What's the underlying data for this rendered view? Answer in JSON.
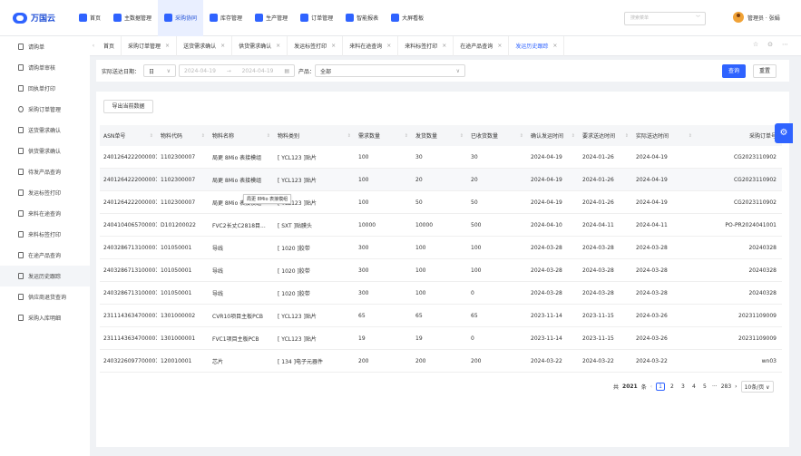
{
  "header": {
    "logo_text": "万国云",
    "nav": [
      {
        "label": "首页",
        "icon": "home-icon",
        "color": "#2f63ff"
      },
      {
        "label": "主数据管理",
        "icon": "database-icon",
        "color": "#2f63ff"
      },
      {
        "label": "采购协同",
        "icon": "cart-icon",
        "color": "#2f63ff"
      },
      {
        "label": "库存管理",
        "icon": "warehouse-icon",
        "color": "#2f63ff"
      },
      {
        "label": "生产管理",
        "icon": "production-icon",
        "color": "#2f63ff"
      },
      {
        "label": "订单管理",
        "icon": "order-icon",
        "color": "#2f63ff"
      },
      {
        "label": "智能报表",
        "icon": "report-icon",
        "color": "#2f63ff"
      },
      {
        "label": "大屏看板",
        "icon": "dashboard-icon",
        "color": "#2f63ff"
      }
    ],
    "search_placeholder": "搜索菜单",
    "user_label": "管理员 · 张娟"
  },
  "sidebar": {
    "items": [
      {
        "label": "请购单"
      },
      {
        "label": "请购单审核"
      },
      {
        "label": "回执单打印"
      },
      {
        "label": "采购订单管理"
      },
      {
        "label": "送货需求确认"
      },
      {
        "label": "供货需求确认"
      },
      {
        "label": "待发产品查询"
      },
      {
        "label": "发运标签打印"
      },
      {
        "label": "来料在途查询"
      },
      {
        "label": "来料标签打印"
      },
      {
        "label": "在途产品查询"
      },
      {
        "label": "发运历史跟踪"
      },
      {
        "label": "供应商退货查询"
      },
      {
        "label": "采购入库明细"
      }
    ]
  },
  "tabs": [
    {
      "label": "首页"
    },
    {
      "label": "采购订单管理"
    },
    {
      "label": "送货需求确认"
    },
    {
      "label": "供货需求确认"
    },
    {
      "label": "发运标签打印"
    },
    {
      "label": "来料在途查询"
    },
    {
      "label": "来料标签打印"
    },
    {
      "label": "在途产品查询"
    },
    {
      "label": "发运历史跟踪"
    }
  ],
  "filter": {
    "date_label": "实际送达日期：",
    "date_type": "日",
    "date_start": "2024-04-19",
    "date_sep": "→",
    "date_end": "2024-04-19",
    "product_label": "产品：",
    "product_value": "全部",
    "search_label": "查询",
    "reset_label": "重置"
  },
  "table": {
    "export_label": "导出当前数据",
    "columns": [
      "ASN单号",
      "物料代码",
      "物料名称",
      "物料类别",
      "需求数量",
      "发货数量",
      "已收货数量",
      "确认发运时间",
      "要求送达时间",
      "实际送达时间",
      "采购订单号"
    ],
    "rows": [
      [
        "2401264222000001",
        "1102300007",
        "局更 8Mio 表接模组",
        "[ YCL123 ]贴片",
        "100",
        "30",
        "30",
        "2024-04-19",
        "2024-01-26",
        "2024-04-19",
        "CG2023110902"
      ],
      [
        "2401264222000001",
        "1102300007",
        "局更 8Mio 表接模组",
        "[ YCL123 ]贴片",
        "100",
        "20",
        "20",
        "2024-04-19",
        "2024-01-26",
        "2024-04-19",
        "CG2023110902"
      ],
      [
        "2401264222000001",
        "1102300007",
        "局更 8Mio 表接模组",
        "[ YCL123 ]贴片",
        "100",
        "50",
        "50",
        "2024-04-19",
        "2024-01-26",
        "2024-04-19",
        "CG2023110902"
      ],
      [
        "2404104065700001",
        "D101200022",
        "FVC2长丈C2818目...",
        "[ SXT ]贴膜头",
        "10000",
        "10000",
        "500",
        "2024-04-10",
        "2024-04-11",
        "2024-04-11",
        "PO-PR2024041001"
      ],
      [
        "2403286713100001",
        "101050001",
        "导线",
        "[ 1020 ]胶带",
        "300",
        "100",
        "100",
        "2024-03-28",
        "2024-03-28",
        "2024-03-28",
        "20240328"
      ],
      [
        "2403286713100001",
        "101050001",
        "导线",
        "[ 1020 ]胶带",
        "300",
        "100",
        "100",
        "2024-03-28",
        "2024-03-28",
        "2024-03-28",
        "20240328"
      ],
      [
        "2403286713100001",
        "101050001",
        "导线",
        "[ 1020 ]胶带",
        "300",
        "100",
        "0",
        "2024-03-28",
        "2024-03-28",
        "2024-03-28",
        "20240328"
      ],
      [
        "2311143634700001",
        "1301000002",
        "CVR10项目主板PCB",
        "[ YCL123 ]贴片",
        "65",
        "65",
        "65",
        "2023-11-14",
        "2023-11-15",
        "2024-03-26",
        "20231109009"
      ],
      [
        "2311143634700001",
        "1301000001",
        "FVC1项目主板PCB",
        "[ YCL123 ]贴片",
        "19",
        "19",
        "0",
        "2023-11-14",
        "2023-11-15",
        "2024-03-26",
        "20231109009"
      ],
      [
        "2403226097700001",
        "120010001",
        "芯片",
        "[ 134 ]电子元器件",
        "200",
        "200",
        "200",
        "2024-03-22",
        "2024-03-22",
        "2024-03-22",
        "wn03"
      ]
    ],
    "tooltip": "局更 8Mio 表接模组"
  },
  "pagination": {
    "total_prefix": "共",
    "total": "2021",
    "total_suffix": "条",
    "pages": [
      "1",
      "2",
      "3",
      "4",
      "5"
    ],
    "ellipsis": "···",
    "last_page": "283",
    "page_size": "10条/页"
  }
}
